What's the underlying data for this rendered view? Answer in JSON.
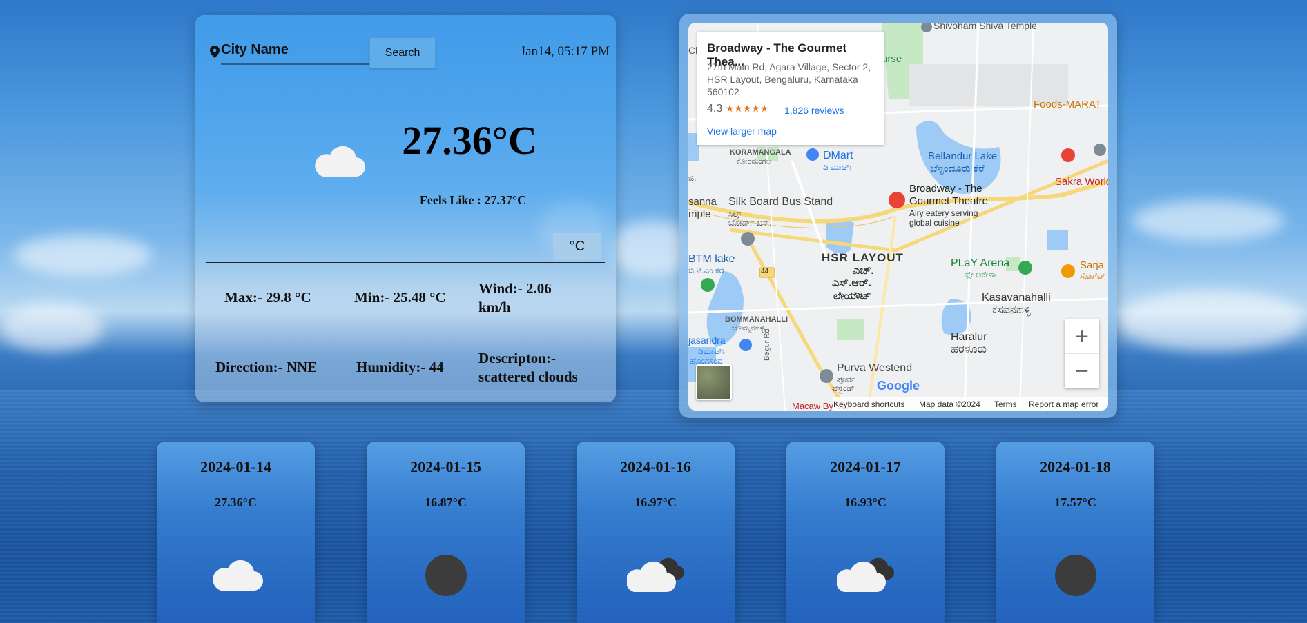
{
  "search": {
    "placeholder": "City Name",
    "button_label": "Search"
  },
  "datetime": "Jan14, 05:17 PM",
  "current": {
    "temperature": "27.36°C",
    "feels_like": "Feels Like : 27.37°C",
    "unit_toggle": "°C",
    "icon": "cloud-icon",
    "max": "Max:- 29.8 °C",
    "min": "Min:- 25.48 °C",
    "wind_line1": "Wind:- 2.06",
    "wind_line2": "km/h",
    "direction": "Direction:- NNE",
    "humidity": "Humidity:- 44",
    "description_line1": "Descripton:-",
    "description_line2": "scattered clouds"
  },
  "map": {
    "place_name": "Broadway - The Gourmet Thea...",
    "address_line1": "27th Main Rd, Agara Village, Sector 2,",
    "address_line2": "HSR Layout, Bengaluru, Karnataka",
    "address_line3": "560102",
    "rating": "4.3",
    "reviews": "1,826 reviews",
    "larger_map": "View larger map",
    "zoom_in": "+",
    "zoom_out": "−",
    "footer": {
      "shortcuts": "Keyboard shortcuts",
      "map_data": "Map data ©2024",
      "terms": "Terms",
      "report": "Report a map error"
    },
    "labels": {
      "shivoham": "Shivoham Shiva Temple",
      "urse": "urse",
      "foods": "Foods-MARAT",
      "koramangala": "KORAMANGALA",
      "koramangala_kn": "ಕೋರಮಂಗಲ",
      "dmart": "DMart",
      "dmart_kn": "ಡಿ ಮಾರ್ಟ್",
      "bellandur": "Bellandur Lake",
      "bellandur_kn": "ಬೆಳ್ಳಂದೂರು ಕೆರೆ",
      "sakra": "Sakra World",
      "silkboard": "Silk Board Bus Stand",
      "silkboard_kn": "ಸಿಲ್ಕ್",
      "silkboard_kn2": "ಬೋರ್ಡ್ ಬಸ್...",
      "broadway1": "Broadway - The",
      "broadway2": "Gourmet Theatre",
      "broadway_desc1": "Airy eatery serving",
      "broadway_desc2": "global cuisine",
      "sanna": "sanna",
      "mple": "mple",
      "btm": "BTM lake",
      "btm_kn": "ಬಿ.ಟಿ.ಎಂ ಕೆರೆ",
      "hsr": "HSR LAYOUT",
      "hsr_kn1": "ಎಚ್.",
      "hsr_kn2": "ಎಸ್.ಆರ್.",
      "hsr_kn3": "ಲೇಯೌಟ್",
      "play_arena": "PLaY Arena",
      "play_arena_kn": "ಪ್ಲೇ ಅರೇನಾ",
      "sarja": "Sarja",
      "sarja_kn": "ಸೋಗೆಟ್",
      "kasavanahalli": "Kasavanahalli",
      "kasavanahalli_kn": "ಕಸವನಹಳ್ಳಿ",
      "road44": "44",
      "bommanahalli": "BOMMANAHALLI",
      "bommanahalli_kn": "ಬೊಮ್ಮನಹಳ್ಳಿ",
      "haralur": "Haralur",
      "haralur_kn": "ಹರಳೂರು",
      "jasandra": "jasandra",
      "jasandra_kn1": "ಡಿಮಾರ್ಟ್",
      "jasandra_kn2": "ಹೊಂಗಸಂದ್ರ",
      "purva": "Purva Westend",
      "purva_kn1": "ಪೂರ್ವ",
      "purva_kn2": "ವೆಸ್ಟೆಂಡ್",
      "begur": "Begur Rd",
      "macaw": "Macaw By Stor",
      "ji": "ಜಿ.",
      "ch": "Ch",
      "google": "Google"
    }
  },
  "forecast": [
    {
      "date": "2024-01-14",
      "temp": "27.36°C",
      "icon": "cloud-icon"
    },
    {
      "date": "2024-01-15",
      "temp": "16.87°C",
      "icon": "dark-circle-icon"
    },
    {
      "date": "2024-01-16",
      "temp": "16.97°C",
      "icon": "cloudy-icon"
    },
    {
      "date": "2024-01-17",
      "temp": "16.93°C",
      "icon": "cloudy-icon"
    },
    {
      "date": "2024-01-18",
      "temp": "17.57°C",
      "icon": "dark-circle-icon"
    }
  ]
}
